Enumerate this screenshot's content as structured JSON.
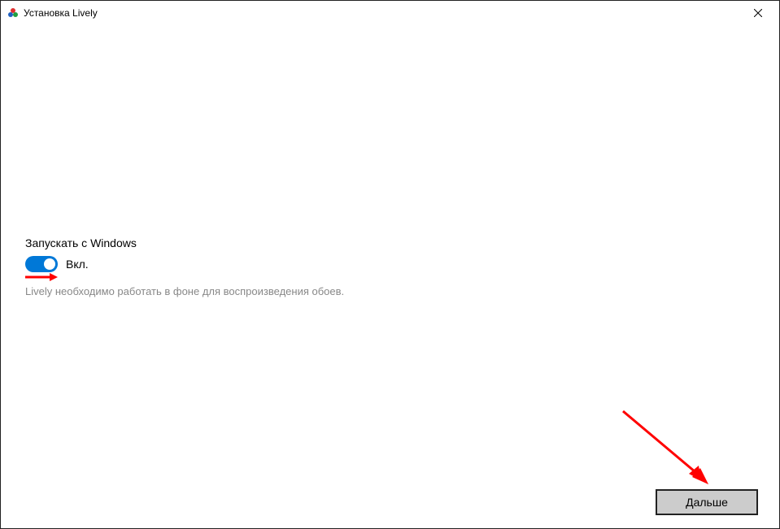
{
  "titlebar": {
    "title": "Установка Lively",
    "icon": "lively-icon"
  },
  "setting": {
    "title": "Запускать с Windows",
    "toggle_state": "on",
    "toggle_label": "Вкл.",
    "description": "Lively необходимо работать в фоне для воспроизведения обоев."
  },
  "footer": {
    "next_label": "Дальше"
  },
  "colors": {
    "accent": "#0078d7",
    "button_bg": "#cccccc",
    "annotation": "#ff0000"
  }
}
